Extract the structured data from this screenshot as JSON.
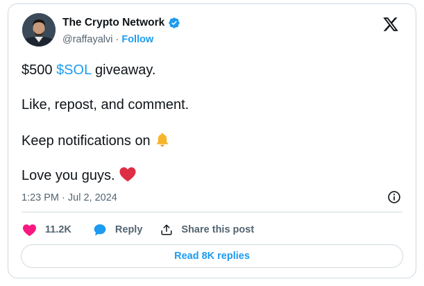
{
  "author": {
    "name": "The Crypto Network",
    "handle": "@raffayalvi",
    "separator": "·",
    "follow_label": "Follow",
    "verified": true
  },
  "tweet": {
    "line1_prefix": "$500 ",
    "line1_cashtag": "$SOL",
    "line1_suffix": " giveaway.",
    "line2": "Like, repost, and comment.",
    "line3": "Keep notifications on",
    "line3_emoji": "bell-icon",
    "line4": "Love you guys.",
    "line4_emoji": "heart-icon"
  },
  "timestamp": "1:23 PM · Jul 2, 2024",
  "actions": {
    "likes": "11.2K",
    "reply_label": "Reply",
    "share_label": "Share this post"
  },
  "read_replies_label": "Read 8K replies",
  "colors": {
    "accent": "#1d9bf0",
    "text": "#0f1419",
    "muted": "#536471",
    "heart": "#f91880",
    "border": "#cfd9de"
  }
}
